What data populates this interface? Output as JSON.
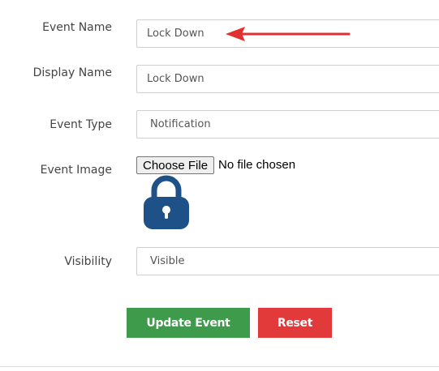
{
  "form": {
    "event_name": {
      "label": "Event Name",
      "value": "Lock Down"
    },
    "display_name": {
      "label": "Display Name",
      "value": "Lock Down"
    },
    "event_type": {
      "label": "Event Type",
      "value": "Notification"
    },
    "event_image": {
      "label": "Event Image",
      "button_label": "Choose File",
      "status_text": "No file chosen",
      "preview_icon": "padlock-icon",
      "preview_color": "#1f5189"
    },
    "visibility": {
      "label": "Visibility",
      "value": "Visible"
    }
  },
  "actions": {
    "update_label": "Update Event",
    "update_color": "#3d9b4b",
    "reset_label": "Reset",
    "reset_color": "#e23a3a"
  },
  "annotation": {
    "icon": "red-arrow-icon",
    "color": "#e0302f"
  }
}
